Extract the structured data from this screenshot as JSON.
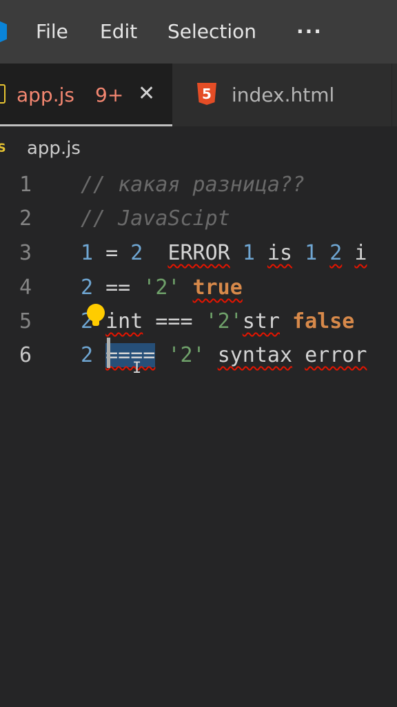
{
  "menu": {
    "items": [
      "File",
      "Edit",
      "Selection"
    ],
    "more": "···"
  },
  "tabs": [
    {
      "label": "app.js",
      "badge": "9+",
      "close": "✕",
      "active": true
    },
    {
      "label": "index.html",
      "icon": "html5-icon",
      "active": false
    }
  ],
  "breadcrumb": {
    "icon": "JS",
    "label": "app.js"
  },
  "editor": {
    "lines": [
      {
        "number": "1",
        "tokens": [
          {
            "text": "// какая разница??",
            "kind": "comment"
          }
        ]
      },
      {
        "number": "2",
        "tokens": [
          {
            "text": "// JavaScipt",
            "kind": "comment"
          }
        ]
      },
      {
        "number": "3",
        "tokens": [
          {
            "text": "1",
            "kind": "num"
          },
          {
            "text": " = ",
            "kind": "op"
          },
          {
            "text": "2",
            "kind": "num"
          },
          {
            "text": "  ",
            "kind": "op"
          },
          {
            "text": "ERROR",
            "kind": "ident",
            "squiggle": true
          },
          {
            "text": " ",
            "kind": "op"
          },
          {
            "text": "1",
            "kind": "num"
          },
          {
            "text": " ",
            "kind": "op"
          },
          {
            "text": "is",
            "kind": "ident",
            "squiggle": true
          },
          {
            "text": " ",
            "kind": "op"
          },
          {
            "text": "1",
            "kind": "num"
          },
          {
            "text": " ",
            "kind": "op"
          },
          {
            "text": "2",
            "kind": "num",
            "squiggle": true
          },
          {
            "text": " ",
            "kind": "op"
          },
          {
            "text": "i",
            "kind": "ident",
            "squiggle": true
          }
        ]
      },
      {
        "number": "4",
        "tokens": [
          {
            "text": "2",
            "kind": "num"
          },
          {
            "text": " == ",
            "kind": "op"
          },
          {
            "text": "'2'",
            "kind": "str"
          },
          {
            "text": " ",
            "kind": "op"
          },
          {
            "text": "true",
            "kind": "bool",
            "squiggle": true
          }
        ]
      },
      {
        "number": "5",
        "tokens": [
          {
            "text": "2",
            "kind": "num"
          },
          {
            "text": " ",
            "kind": "op"
          },
          {
            "text": "int",
            "kind": "ident",
            "squiggle": true
          },
          {
            "text": " === ",
            "kind": "op"
          },
          {
            "text": "'2'",
            "kind": "str"
          },
          {
            "text": "str",
            "kind": "ident",
            "squiggle": true
          },
          {
            "text": " ",
            "kind": "op"
          },
          {
            "text": "false",
            "kind": "bool"
          }
        ]
      },
      {
        "number": "6",
        "current": true,
        "tokens": [
          {
            "text": "2",
            "kind": "num"
          },
          {
            "text": " ",
            "kind": "op"
          },
          {
            "text": "====",
            "kind": "op",
            "squiggle": true,
            "selected": true
          },
          {
            "text": " ",
            "kind": "op"
          },
          {
            "text": "'2'",
            "kind": "str"
          },
          {
            "text": " ",
            "kind": "op"
          },
          {
            "text": "syntax",
            "kind": "ident",
            "squiggle": true
          },
          {
            "text": " ",
            "kind": "op"
          },
          {
            "text": "error",
            "kind": "ident",
            "squiggle": true
          }
        ]
      }
    ],
    "lightbulb_icon": "lightbulb-icon",
    "ibeam": "I"
  },
  "colors": {
    "background": "#252526",
    "menubar": "#3c3c3c",
    "tab_active_label": "#f48771",
    "js_yellow": "#e8c431",
    "html_orange": "#e44d26",
    "number": "#6fa6d2",
    "string": "#6fa16a",
    "boolean": "#d7894a",
    "comment": "#6a6a6a",
    "error_squiggle": "#e51400",
    "selection": "#264f78"
  }
}
